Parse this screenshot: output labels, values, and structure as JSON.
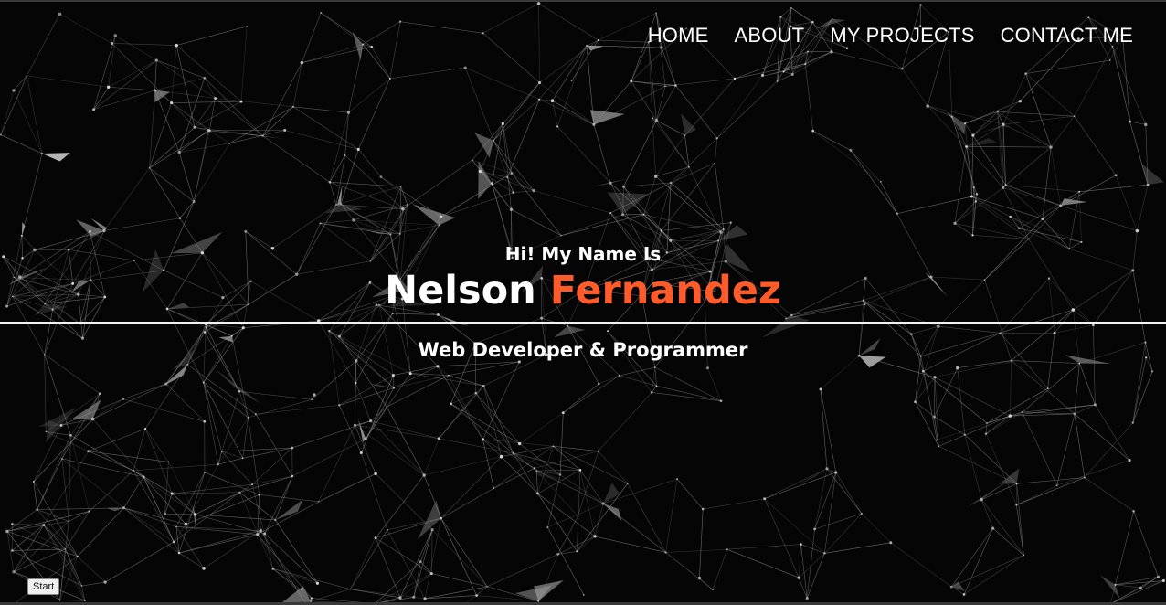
{
  "nav": {
    "items": [
      {
        "label": "HOME"
      },
      {
        "label": "ABOUT"
      },
      {
        "label": "MY PROJECTS"
      },
      {
        "label": "CONTACT ME"
      }
    ]
  },
  "hero": {
    "greeting": "Hi! My Name Is",
    "first_name": "Nelson",
    "last_name": "Fernandez",
    "tagline": "Web Developer & Programmer"
  },
  "controls": {
    "start_label": "Start"
  },
  "colors": {
    "background": "#050505",
    "accent": "#ff5a2a",
    "text": "#ffffff",
    "network_lines": "#9a9a9a"
  },
  "background_pattern": "particle-network"
}
